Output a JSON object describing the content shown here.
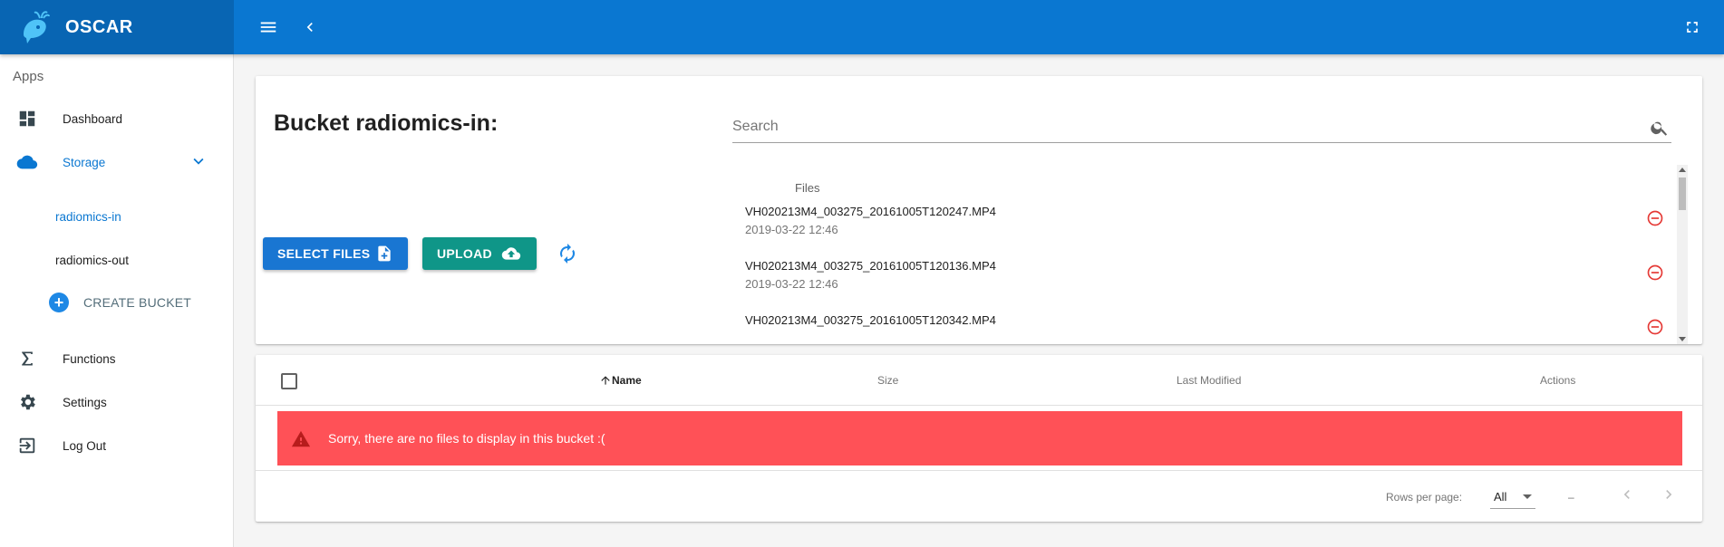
{
  "app": {
    "name": "OSCAR",
    "colors": {
      "primary": "#0a77d1",
      "primary_dark": "#0865b3",
      "select_button": "#1976d2",
      "upload_button": "#0f9688",
      "alert": "#ff5157",
      "remove_icon": "#e53935"
    }
  },
  "header": {
    "menu_icon": "menu-icon",
    "back_icon": "chevron-left-icon",
    "fullscreen_icon": "fullscreen-icon"
  },
  "sidebar": {
    "subheader": "Apps",
    "items": [
      {
        "label": "Dashboard",
        "icon": "dashboard-icon"
      },
      {
        "label": "Storage",
        "icon": "cloud-icon",
        "expanded": true
      },
      {
        "label": "Functions",
        "icon": "sigma-icon"
      },
      {
        "label": "Settings",
        "icon": "gear-icon"
      },
      {
        "label": "Log Out",
        "icon": "logout-icon"
      }
    ],
    "buckets": [
      {
        "label": "radiomics-in",
        "selected": true
      },
      {
        "label": "radiomics-out",
        "selected": false
      }
    ],
    "create_bucket_label": "CREATE BUCKET"
  },
  "bucket": {
    "title_prefix": "Bucket ",
    "name": "radiomics-in",
    "title_suffix": ":"
  },
  "search": {
    "placeholder": "Search",
    "value": ""
  },
  "buttons": {
    "select_files": "SELECT FILES",
    "upload": "UPLOAD"
  },
  "files": {
    "header": "Files",
    "items": [
      {
        "name": "VH020213M4_003275_20161005T120247.MP4",
        "date": "2019-03-22 12:46"
      },
      {
        "name": "VH020213M4_003275_20161005T120136.MP4",
        "date": "2019-03-22 12:46"
      },
      {
        "name": "VH020213M4_003275_20161005T120342.MP4",
        "date": ""
      }
    ]
  },
  "table": {
    "columns": {
      "name": "Name",
      "size": "Size",
      "modified": "Last Modified",
      "actions": "Actions"
    },
    "empty_message": "Sorry, there are no files to display in this bucket :(",
    "rows_per_page_label": "Rows per page:",
    "rows_per_page_value": "All",
    "range": "–"
  }
}
